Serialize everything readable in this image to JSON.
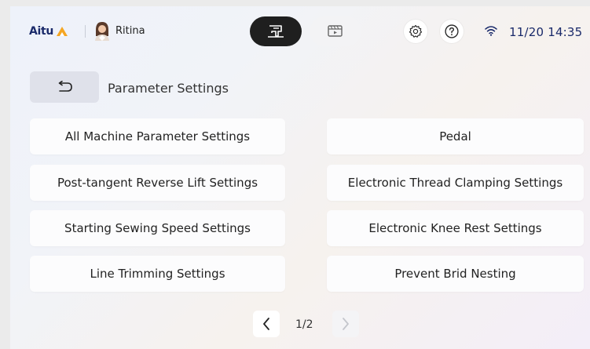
{
  "brand": {
    "name": "Aitu",
    "accent": "#f5a623",
    "color": "#1a2a6a"
  },
  "user": {
    "name": "Ritina"
  },
  "mode_switch": {
    "items": [
      {
        "icon": "sewing-machine-icon",
        "active": true
      },
      {
        "icon": "video-screen-icon",
        "active": false
      }
    ]
  },
  "status": {
    "icons": [
      "gear-icon",
      "help-icon",
      "wifi-icon"
    ],
    "datetime": "11/20 14:35"
  },
  "page": {
    "title": "Parameter Settings",
    "back_icon": "back-arrow-icon"
  },
  "settings": {
    "left": [
      "All Machine Parameter Settings",
      "Post-tangent Reverse Lift Settings",
      "Starting Sewing Speed Settings",
      "Line Trimming Settings"
    ],
    "right": [
      "Pedal",
      "Electronic Thread Clamping Settings",
      "Electronic Knee Rest Settings",
      "Prevent Brid Nesting"
    ]
  },
  "pagination": {
    "current": 1,
    "total": 2,
    "label": "1/2"
  }
}
